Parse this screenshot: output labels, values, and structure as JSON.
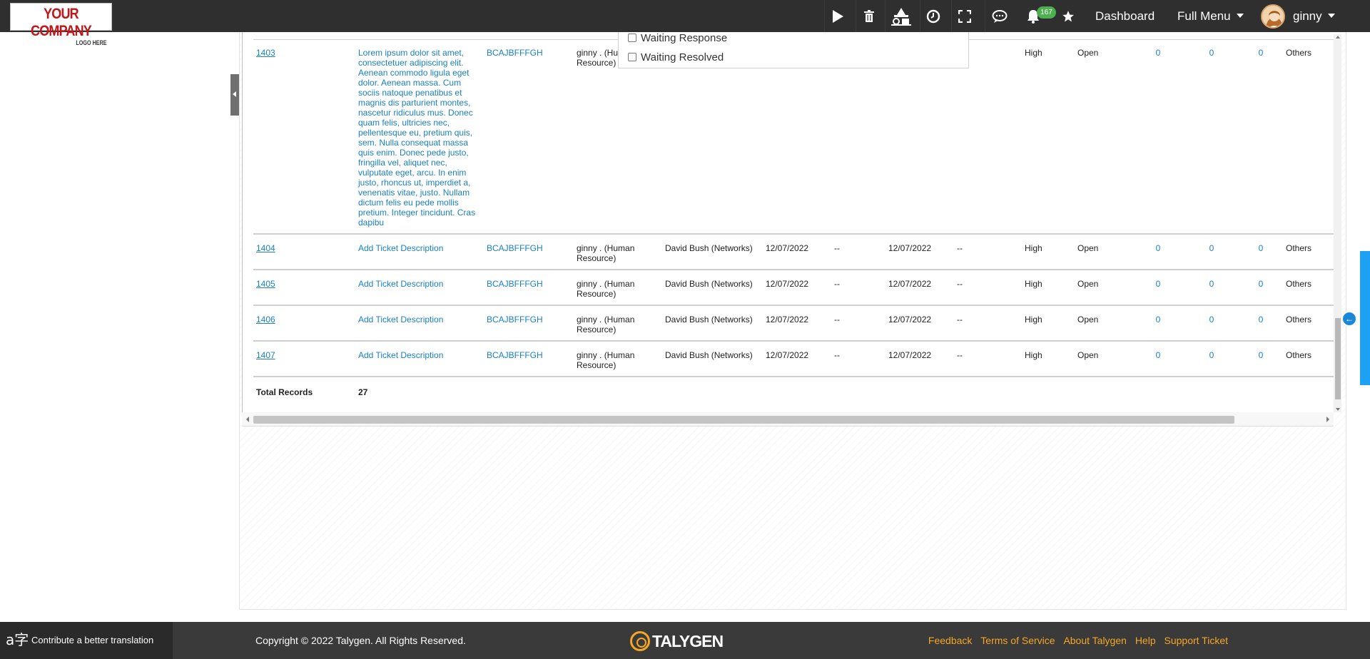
{
  "header": {
    "logo_line1": "YOUR COMPANY",
    "logo_line2": "LOGO HERE",
    "notification_count": "167",
    "dashboard_label": "Dashboard",
    "full_menu_label": "Full Menu",
    "user_name": "ginny"
  },
  "status_filter": {
    "options": [
      {
        "label": "Waiting Response",
        "checked": false
      },
      {
        "label": "Waiting Resolved",
        "checked": false
      }
    ]
  },
  "tickets": {
    "rows": [
      {
        "id": "1403",
        "description": "Lorem ipsum dolor sit amet, consectetuer adipiscing elit. Aenean commodo ligula eget dolor. Aenean massa. Cum sociis natoque penatibus et magnis dis parturient montes, nascetur ridiculus mus. Donec quam felis, ultricies nec, pellentesque eu, pretium quis, sem. Nulla consequat massa quis enim. Donec pede justo, fringilla vel, aliquet nec, vulputate eget, arcu. In enim justo, rhoncus ut, imperdiet a, venenatis vitae, justo. Nullam dictum felis eu pede mollis pretium. Integer tincidunt. Cras dapibu",
        "code": "BCAJBFFFGH",
        "requester": "ginny . (Human Resource)",
        "assignee": "",
        "created": "",
        "col7": "",
        "due": "",
        "col9": "",
        "priority": "High",
        "status": "Open",
        "n1": "0",
        "n2": "0",
        "n3": "0",
        "category": "Others"
      },
      {
        "id": "1404",
        "description": "Add Ticket Description",
        "code": "BCAJBFFFGH",
        "requester": "ginny . (Human Resource)",
        "assignee": "David Bush (Networks)",
        "created": "12/07/2022",
        "col7": "--",
        "due": "12/07/2022",
        "col9": "--",
        "priority": "High",
        "status": "Open",
        "n1": "0",
        "n2": "0",
        "n3": "0",
        "category": "Others"
      },
      {
        "id": "1405",
        "description": "Add Ticket Description",
        "code": "BCAJBFFFGH",
        "requester": "ginny . (Human Resource)",
        "assignee": "David Bush (Networks)",
        "created": "12/07/2022",
        "col7": "--",
        "due": "12/07/2022",
        "col9": "--",
        "priority": "High",
        "status": "Open",
        "n1": "0",
        "n2": "0",
        "n3": "0",
        "category": "Others"
      },
      {
        "id": "1406",
        "description": "Add Ticket Description",
        "code": "BCAJBFFFGH",
        "requester": "ginny . (Human Resource)",
        "assignee": "David Bush (Networks)",
        "created": "12/07/2022",
        "col7": "--",
        "due": "12/07/2022",
        "col9": "--",
        "priority": "High",
        "status": "Open",
        "n1": "0",
        "n2": "0",
        "n3": "0",
        "category": "Others"
      },
      {
        "id": "1407",
        "description": "Add Ticket Description",
        "code": "BCAJBFFFGH",
        "requester": "ginny . (Human Resource)",
        "assignee": "David Bush (Networks)",
        "created": "12/07/2022",
        "col7": "--",
        "due": "12/07/2022",
        "col9": "--",
        "priority": "High",
        "status": "Open",
        "n1": "0",
        "n2": "0",
        "n3": "0",
        "category": "Others"
      }
    ],
    "total_label": "Total Records",
    "total_value": "27"
  },
  "footer": {
    "translate_label": "Contribute a better translation",
    "copyright": "Copyright © 2022 Talygen. All Rights Reserved.",
    "brand": "TALYGEN",
    "links": [
      "Feedback",
      "Terms of Service",
      "About Talygen",
      "Help",
      "Support Ticket"
    ]
  },
  "colors": {
    "header_bg": "#2f2f2f",
    "link_blue": "#1a80c4",
    "accent_orange": "#f5a623",
    "badge_green": "#4caf50"
  }
}
